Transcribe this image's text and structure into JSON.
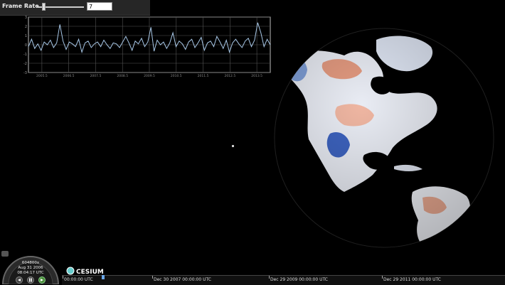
{
  "controls": {
    "frame_rate_label": "Frame Rate",
    "frame_rate_value": "7",
    "frame_rate_slider_fraction": 0.14
  },
  "chart_data": {
    "type": "line",
    "ylim": [
      -3,
      3
    ],
    "y_tick_labels": [
      "3",
      "2",
      "1",
      "0",
      "-1",
      "-2",
      "-3"
    ],
    "x_tick_labels": [
      "2005.5",
      "2006.5",
      "2007.5",
      "2008.5",
      "2009.5",
      "2010.5",
      "2011.5",
      "2012.5",
      "2013.5"
    ],
    "series": [
      {
        "values": [
          -0.2,
          0.6,
          -0.4,
          0.1,
          -0.6,
          0.3,
          0.0,
          0.5,
          -0.3,
          0.2,
          2.2,
          0.4,
          -0.5,
          0.3,
          0.1,
          -0.2,
          0.6,
          -0.8,
          0.2,
          0.4,
          -0.3,
          0.1,
          0.3,
          -0.2,
          0.5,
          0.0,
          -0.4,
          0.2,
          0.1,
          -0.3,
          0.3,
          0.9,
          0.2,
          -0.6,
          0.4,
          0.1,
          0.7,
          -0.2,
          0.3,
          1.9,
          -0.7,
          0.5,
          0.0,
          0.3,
          -0.4,
          0.2,
          1.3,
          -0.2,
          0.4,
          0.1,
          -0.5,
          0.3,
          0.6,
          -0.3,
          0.2,
          0.8,
          -0.6,
          0.2,
          0.4,
          -0.2,
          0.9,
          0.3,
          -0.4,
          0.5,
          -0.8,
          0.2,
          0.6,
          0.1,
          -0.3,
          0.4,
          0.7,
          -0.2,
          0.5,
          2.4,
          1.3,
          -0.2,
          0.6,
          0.0
        ]
      }
    ]
  },
  "clock": {
    "speed": "604800x",
    "date": "Aug 31 2006",
    "time": "08:04:17 UTC"
  },
  "brand": {
    "name": "CESIUM"
  },
  "timeline": {
    "labels": [
      "00:00:00 UTC",
      "Dec 30 2007 00:00:00 UTC",
      "Dec 29 2009 00:00:00 UTC",
      "Dec 29 2011 00:00:00 UTC"
    ]
  },
  "colors": {
    "warm": "#e8846a",
    "cool": "#4a72c8",
    "accent": "#6aa6e8",
    "chart_line": "#a8c8e8"
  }
}
